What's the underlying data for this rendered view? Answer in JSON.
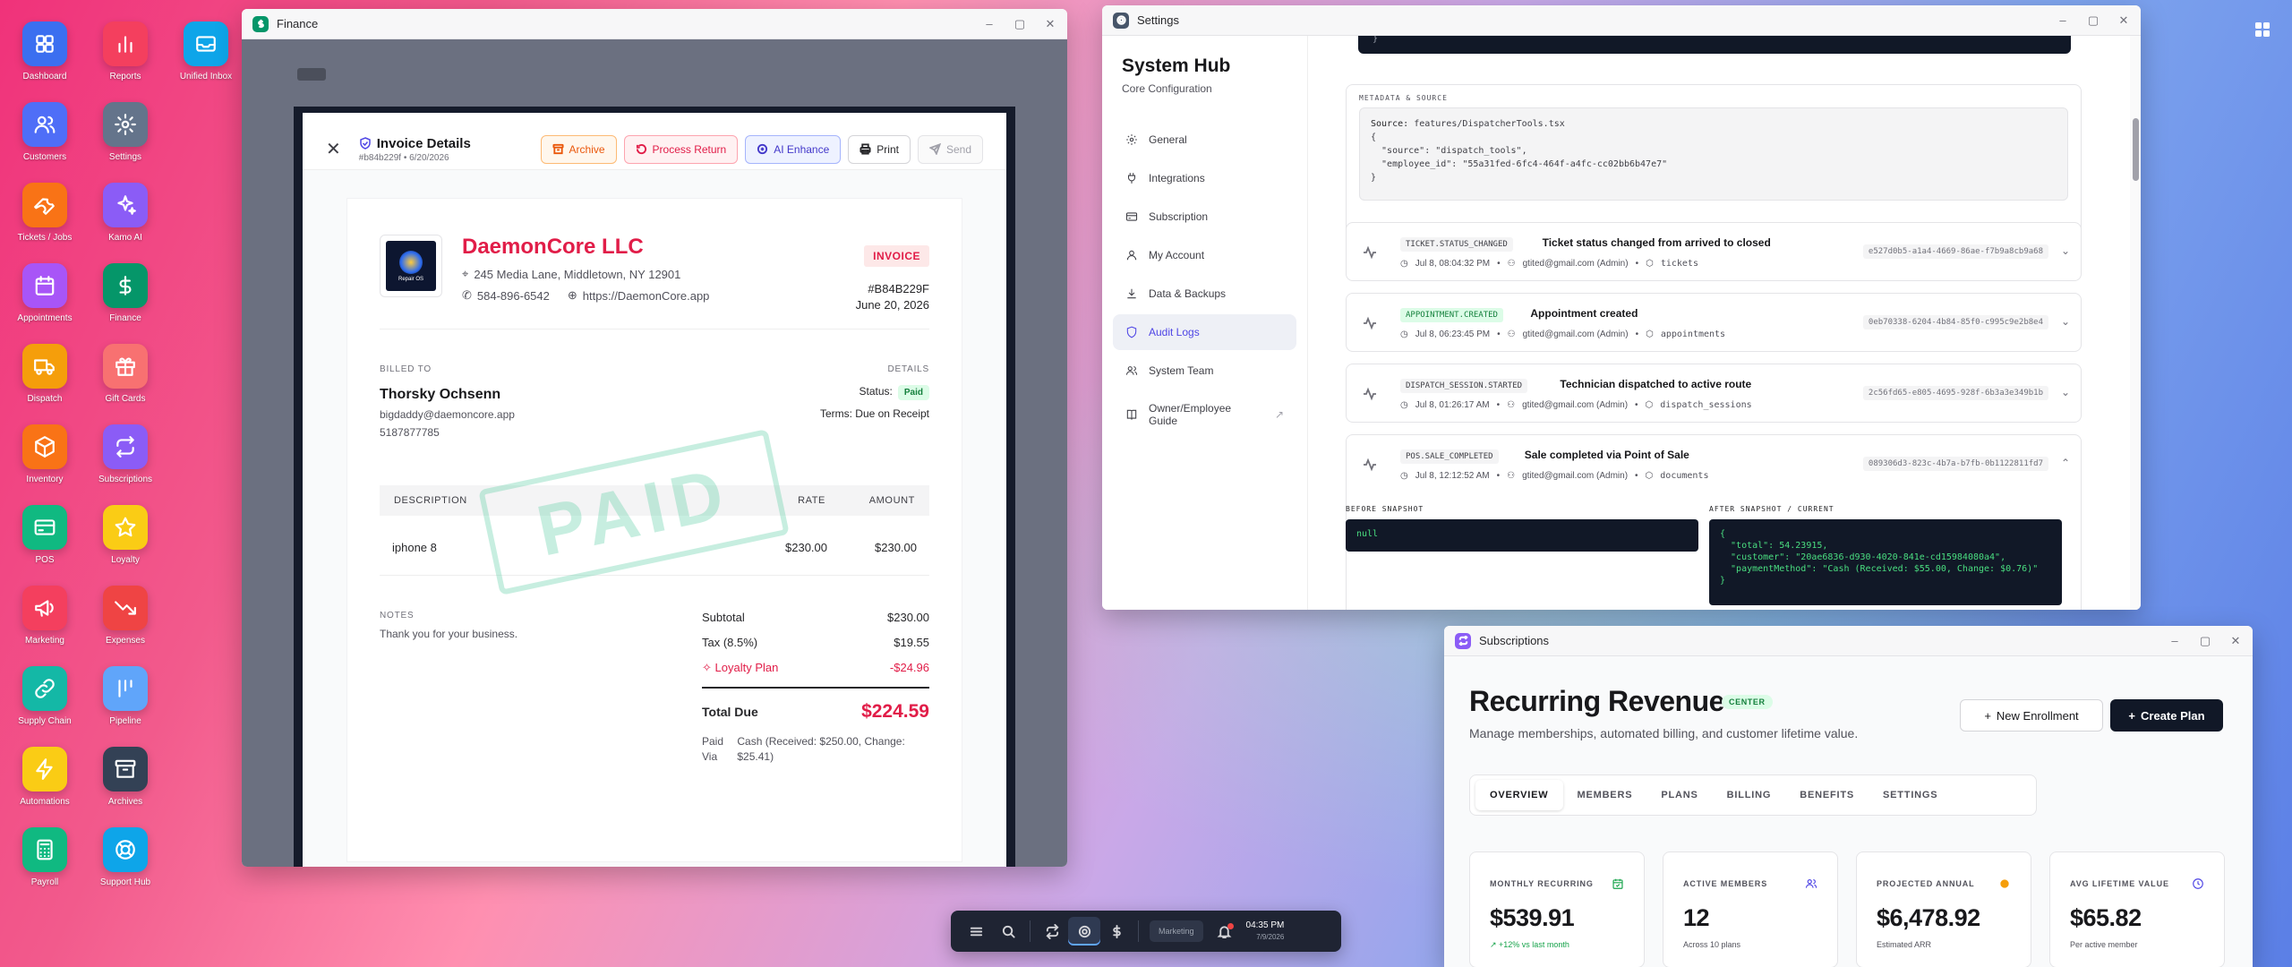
{
  "desktop": {
    "icons": [
      {
        "label": "Dashboard",
        "color": "#3b6ff0",
        "icon": "grid-icon"
      },
      {
        "label": "Reports",
        "color": "#f43f5e",
        "icon": "bar-chart-icon"
      },
      {
        "label": "Unified Inbox",
        "color": "#0ea5e9",
        "icon": "inbox-icon"
      },
      {
        "label": "Customers",
        "color": "#4f6ef7",
        "icon": "users-icon"
      },
      {
        "label": "Settings",
        "color": "#64748b",
        "icon": "gear-icon"
      },
      {
        "label": "Tickets / Jobs",
        "color": "#f97316",
        "icon": "wrench-icon"
      },
      {
        "label": "Kamo AI",
        "color": "#8b5cf6",
        "icon": "sparkles-icon"
      },
      {
        "label": "Appointments",
        "color": "#a855f7",
        "icon": "calendar-icon"
      },
      {
        "label": "Finance",
        "color": "#059669",
        "icon": "dollar-icon"
      },
      {
        "label": "Dispatch",
        "color": "#f59e0b",
        "icon": "truck-icon"
      },
      {
        "label": "Gift Cards",
        "color": "#f87171",
        "icon": "gift-icon"
      },
      {
        "label": "Inventory",
        "color": "#f97316",
        "icon": "box-icon"
      },
      {
        "label": "Subscriptions",
        "color": "#8b5cf6",
        "icon": "repeat-icon"
      },
      {
        "label": "POS",
        "color": "#10b981",
        "icon": "card-icon"
      },
      {
        "label": "Loyalty",
        "color": "#facc15",
        "icon": "star-icon"
      },
      {
        "label": "Marketing",
        "color": "#f43f5e",
        "icon": "megaphone-icon"
      },
      {
        "label": "Expenses",
        "color": "#ef4444",
        "icon": "trend-down-icon"
      },
      {
        "label": "Supply Chain",
        "color": "#14b8a6",
        "icon": "link-icon"
      },
      {
        "label": "Pipeline",
        "color": "#60a5fa",
        "icon": "kanban-icon"
      },
      {
        "label": "Automations",
        "color": "#facc15",
        "icon": "bolt-icon"
      },
      {
        "label": "Archives",
        "color": "#334155",
        "icon": "archive-icon"
      },
      {
        "label": "Payroll",
        "color": "#10b981",
        "icon": "calculator-icon"
      },
      {
        "label": "Support Hub",
        "color": "#0ea5e9",
        "icon": "lifebuoy-icon"
      }
    ]
  },
  "finance": {
    "window_title": "Finance",
    "invoice_header": {
      "title": "Invoice Details",
      "subtitle": "#b84b229f • 6/20/2026",
      "archive": "Archive",
      "process_return": "Process Return",
      "ai_enhance": "AI Enhance",
      "print": "Print",
      "send": "Send"
    },
    "invoice": {
      "company": "DaemonCore LLC",
      "logo_text": "Repair OS",
      "address": "245 Media Lane, Middletown, NY 12901",
      "phone": "584-896-6542",
      "website": "https://DaemonCore.app",
      "badge": "INVOICE",
      "number": "#B84B229F",
      "date": "June 20, 2026",
      "billed_to_label": "BILLED TO",
      "customer_name": "Thorsky Ochsenn",
      "customer_email": "bigdaddy@daemoncore.app",
      "customer_phone": "5187877785",
      "details_label": "DETAILS",
      "status_label": "Status:",
      "status_value": "Paid",
      "terms_label": "Terms:",
      "terms_value": "Due on Receipt",
      "col_description": "DESCRIPTION",
      "col_rate": "RATE",
      "col_amount": "AMOUNT",
      "item_description": "iphone 8",
      "item_rate": "$230.00",
      "item_amount": "$230.00",
      "stamp": "PAID",
      "notes_label": "NOTES",
      "notes": "Thank you for your business.",
      "subtotal_label": "Subtotal",
      "subtotal": "$230.00",
      "tax_label": "Tax (8.5%)",
      "tax": "$19.55",
      "loyalty_label": "Loyalty Plan",
      "loyalty": "-$24.96",
      "total_label": "Total Due",
      "total": "$224.59",
      "paid_via_label": "Paid Via",
      "paid_via": "Cash (Received: $250.00, Change: $25.41)"
    }
  },
  "settings": {
    "window_title": "Settings",
    "hub_title": "System Hub",
    "hub_subtitle": "Core Configuration",
    "nav": [
      {
        "label": "General",
        "icon": "gear-icon"
      },
      {
        "label": "Integrations",
        "icon": "plug-icon"
      },
      {
        "label": "Subscription",
        "icon": "card-icon"
      },
      {
        "label": "My Account",
        "icon": "user-icon"
      },
      {
        "label": "Data & Backups",
        "icon": "download-icon"
      },
      {
        "label": "Audit Logs",
        "icon": "shield-icon",
        "active": true
      },
      {
        "label": "System Team",
        "icon": "users-icon"
      },
      {
        "label": "Owner/Employee Guide",
        "icon": "book-icon"
      }
    ],
    "code_top": "}",
    "metadata_label": "METADATA & SOURCE",
    "metadata_source_label": "Source:",
    "metadata_source": "features/DispatcherTools.tsx",
    "metadata_json": "{\n  \"source\": \"dispatch_tools\",\n  \"employee_id\": \"55a31fed-6fc4-464f-a4fc-cc02bb6b47e7\"\n}",
    "logs": [
      {
        "tag": "TICKET.STATUS_CHANGED",
        "tag_style": "gray",
        "message": "Ticket status changed from arrived to closed",
        "time": "Jul 8, 08:04:32 PM",
        "user": "gtited@gmail.com (Admin)",
        "entity": "tickets",
        "hash": "e527d0b5-a1a4-4669-86ae-f7b9a8cb9a68",
        "chevron": "⌄"
      },
      {
        "tag": "APPOINTMENT.CREATED",
        "tag_style": "green",
        "message": "Appointment created",
        "time": "Jul 8, 06:23:45 PM",
        "user": "gtited@gmail.com (Admin)",
        "entity": "appointments",
        "hash": "0eb70338-6204-4b84-85f0-c995c9e2b8e4",
        "chevron": "⌄"
      },
      {
        "tag": "DISPATCH_SESSION.STARTED",
        "tag_style": "gray",
        "message": "Technician dispatched to active route",
        "time": "Jul 8, 01:26:17 AM",
        "user": "gtited@gmail.com (Admin)",
        "entity": "dispatch_sessions",
        "hash": "2c56fd65-e805-4695-928f-6b3a3e349b1b",
        "chevron": "⌄"
      },
      {
        "tag": "POS.SALE_COMPLETED",
        "tag_style": "gray",
        "message": "Sale completed via Point of Sale",
        "time": "Jul 8, 12:12:52 AM",
        "user": "gtited@gmail.com (Admin)",
        "entity": "documents",
        "hash": "089306d3-823c-4b7a-b7fb-0b1122811fd7",
        "chevron": "⌃"
      }
    ],
    "before_label": "BEFORE SNAPSHOT",
    "before_value": "null",
    "after_label": "AFTER SNAPSHOT / CURRENT",
    "after_value": "{\n  \"total\": 54.23915,\n  \"customer\": \"20ae6836-d930-4020-841e-cd15984080a4\",\n  \"paymentMethod\": \"Cash (Received: $55.00, Change: $0.76)\"\n}"
  },
  "subscriptions": {
    "window_title": "Subscriptions",
    "title": "Recurring Revenue",
    "pill": "CENTER",
    "description": "Manage memberships, automated billing, and customer lifetime value.",
    "new_enrollment": "New Enrollment",
    "create_plan": "Create Plan",
    "tabs": [
      "OVERVIEW",
      "MEMBERS",
      "PLANS",
      "BILLING",
      "BENEFITS",
      "SETTINGS"
    ],
    "kpis": [
      {
        "label": "MONTHLY RECURRING",
        "value": "$539.91",
        "sub": "+12% vs last month",
        "icon": "calendar-check-icon",
        "color": "#16a34a"
      },
      {
        "label": "ACTIVE MEMBERS",
        "value": "12",
        "sub": "Across 10 plans",
        "icon": "users-icon",
        "color": "#4f46e5"
      },
      {
        "label": "PROJECTED ANNUAL",
        "value": "$6,478.92",
        "sub": "Estimated ARR",
        "icon": "dot-icon",
        "color": "#f59e0b"
      },
      {
        "label": "AVG LIFETIME VALUE",
        "value": "$65.82",
        "sub": "Per active member",
        "icon": "clock-icon",
        "color": "#4f46e5"
      }
    ]
  },
  "taskbar": {
    "pill": "Marketing",
    "time": "04:35 PM",
    "date": "7/9/2026"
  }
}
